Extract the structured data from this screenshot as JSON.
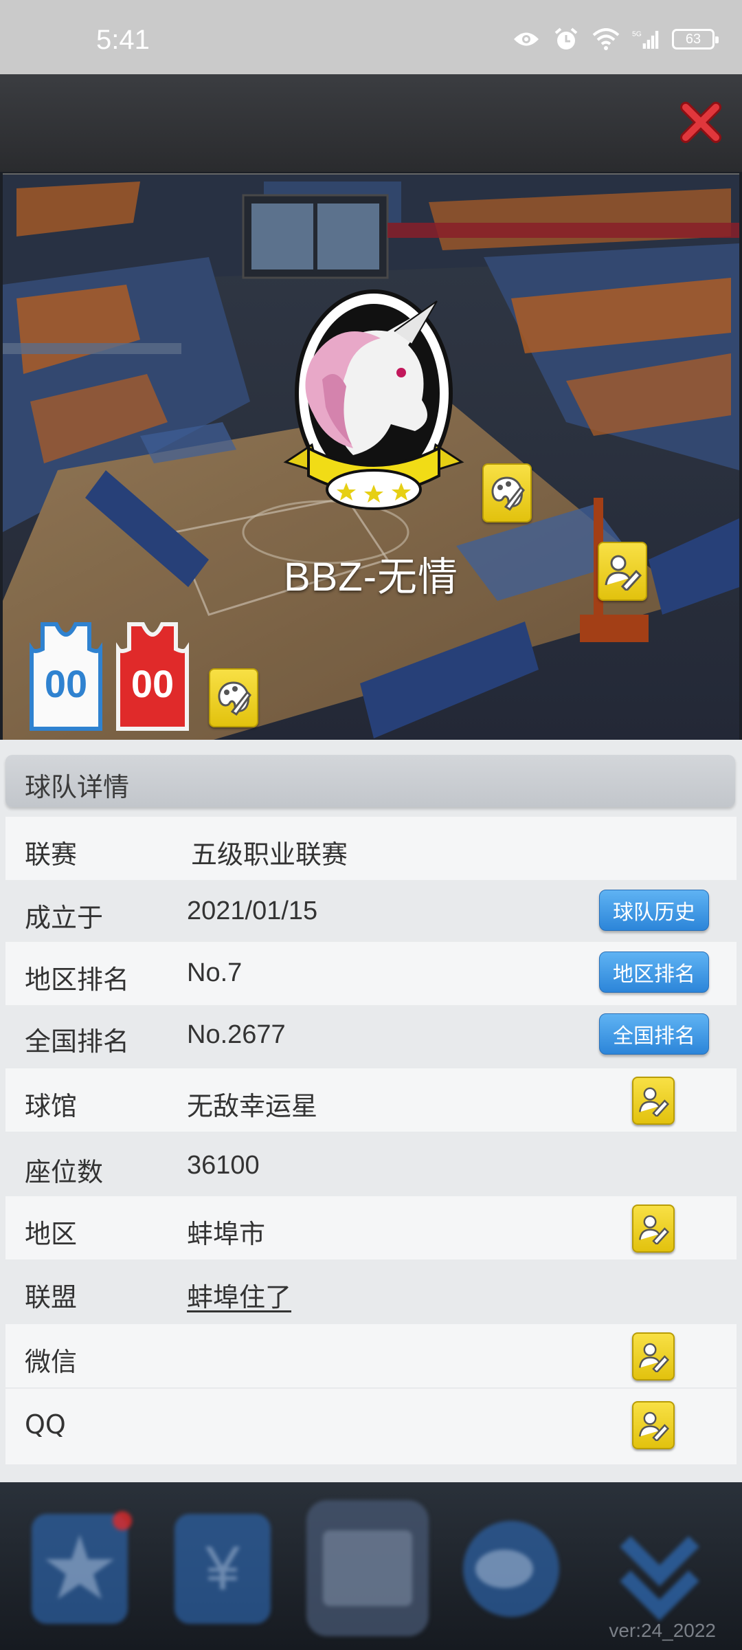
{
  "status_bar": {
    "time": "5:41",
    "battery": "63"
  },
  "team": {
    "name": "BBZ-无情"
  },
  "details": {
    "header": "球队详情",
    "rows": [
      {
        "label": "联赛",
        "value": "五级职业联赛"
      },
      {
        "label": "成立于",
        "value": "2021/01/15",
        "button": "球队历史"
      },
      {
        "label": "地区排名",
        "value": "No.7",
        "button": "地区排名"
      },
      {
        "label": "全国排名",
        "value": "No.2677",
        "button": "全国排名"
      },
      {
        "label": "球馆",
        "value": "无敌幸运星"
      },
      {
        "label": "座位数",
        "value": "36100"
      },
      {
        "label": "地区",
        "value": "蚌埠市"
      },
      {
        "label": "联盟",
        "value": "蚌埠住了"
      },
      {
        "label": "微信",
        "value": ""
      },
      {
        "label": "QQ",
        "value": ""
      }
    ]
  },
  "jerseys": {
    "home_number": "00",
    "away_number": "00",
    "home_color": "#ffffff",
    "away_color": "#e02a2a"
  },
  "colors": {
    "accent_blue": "#3a95e6",
    "edit_yellow": "#f0d22a",
    "close_red": "#d9262c"
  },
  "footer": {
    "version": "ver:24_2022"
  }
}
